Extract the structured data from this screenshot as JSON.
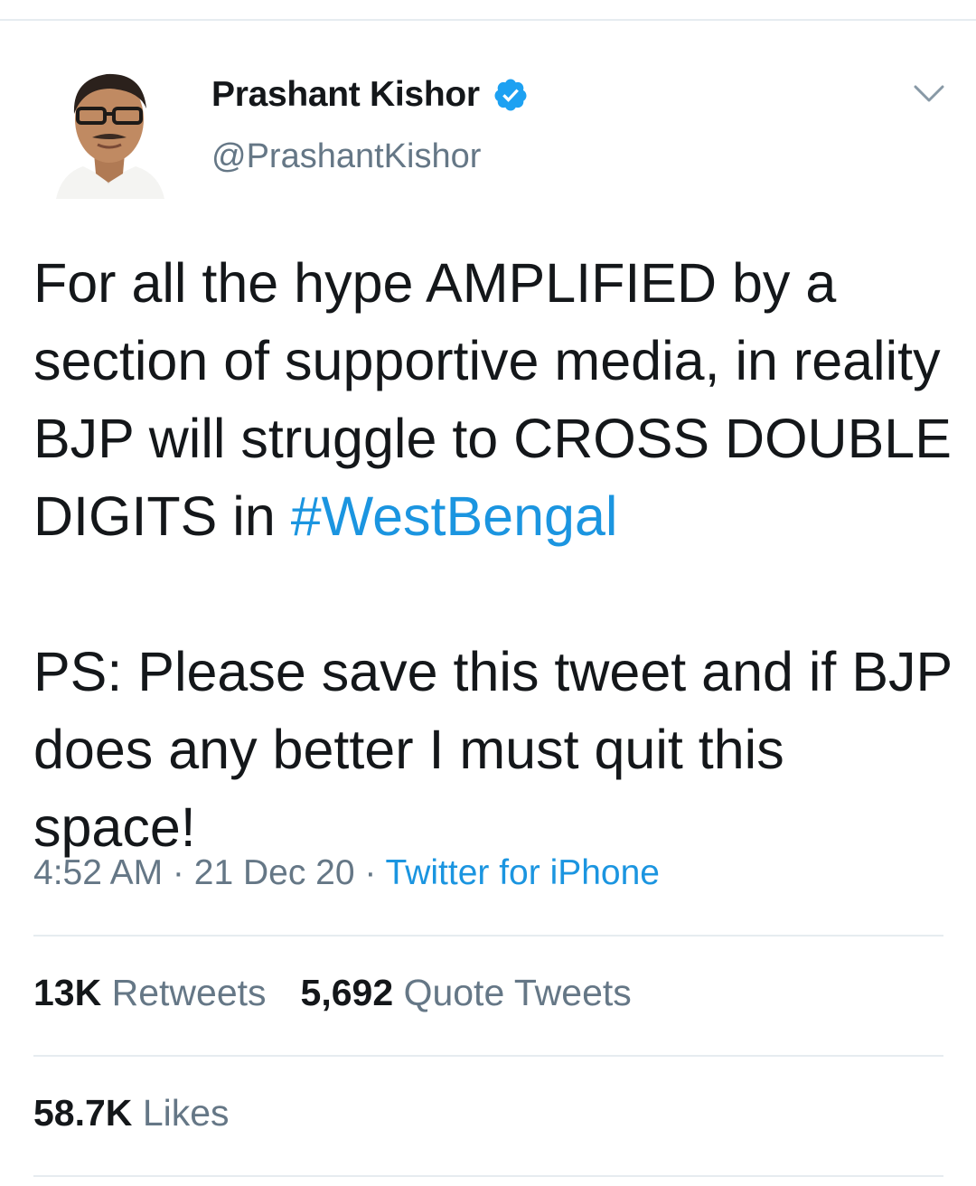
{
  "tweet": {
    "author": {
      "display_name": "Prashant Kishor",
      "handle": "@PrashantKishor",
      "verified": true
    },
    "text": {
      "para1_before": "For all the hype AMPLIFIED by a section of supportive media, in reality BJP will struggle to CROSS DOUBLE DIGITS in ",
      "hashtag": "#WestBengal",
      "para2": "PS: Please save this tweet and if BJP does any better I must quit this space!"
    },
    "meta": {
      "time": "4:52 AM",
      "sep1": " · ",
      "date": "21 Dec 20",
      "sep2": " · ",
      "source": "Twitter for iPhone"
    },
    "stats": {
      "retweets_count": "13K",
      "retweets_label": "Retweets",
      "quotes_count": "5,692",
      "quotes_label": "Quote Tweets",
      "likes_count": "58.7K",
      "likes_label": "Likes"
    }
  },
  "icons": {
    "verified": "verified-badge-icon",
    "menu": "chevron-down-icon"
  },
  "colors": {
    "accent": "#1b95e0",
    "text_primary": "#14171a",
    "text_secondary": "#657786",
    "divider": "#e6ecf0"
  }
}
